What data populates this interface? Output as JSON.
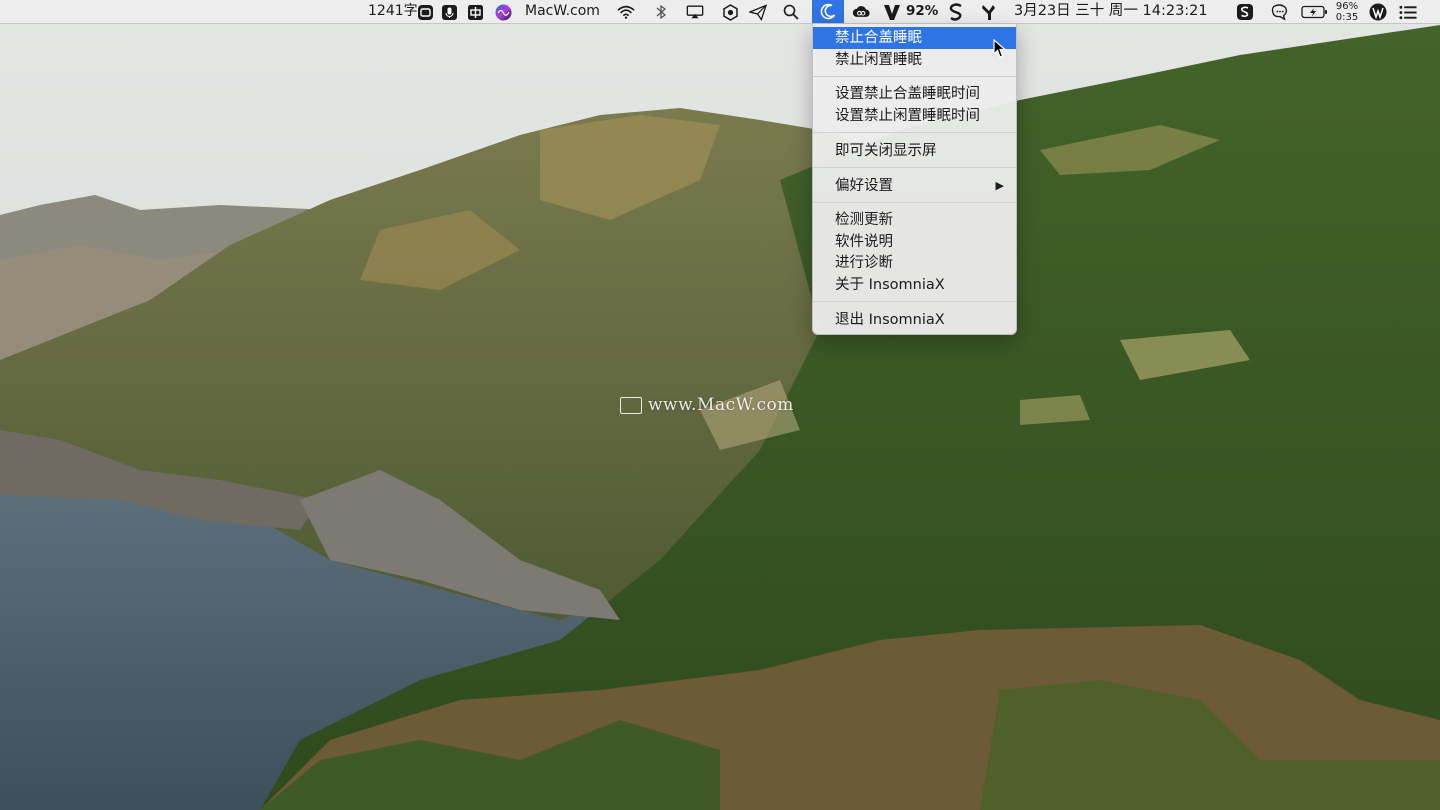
{
  "menubar": {
    "word_count": "1241字",
    "site_label": "MacW.com",
    "battery_percent_text": "92%",
    "datetime": "3月23日 三十 周一 14:23:21",
    "battery_small_percent": "96%",
    "battery_small_time": "0:35",
    "icons": [
      "scanner-icon",
      "microphone-icon",
      "input-method-icon",
      "siri-icon",
      "wifi-icon",
      "bluetooth-icon",
      "airplay-icon",
      "hex-app-icon",
      "paper-plane-icon",
      "search-icon",
      "insomniax-icon",
      "creative-cloud-icon",
      "vectorize-icon",
      "scrivener-icon",
      "tool-icon",
      "sketch-app-icon",
      "chat-icon",
      "battery-charging-icon",
      "wordpress-icon",
      "list-icon"
    ]
  },
  "menu": {
    "items": [
      {
        "label": "禁止合盖睡眠",
        "highlighted": true
      },
      {
        "label": "禁止闲置睡眠"
      },
      {
        "label": "设置禁止合盖睡眠时间"
      },
      {
        "label": "设置禁止闲置睡眠时间"
      },
      {
        "label": "即可关闭显示屏"
      },
      {
        "label": "偏好设置",
        "submenu": true
      },
      {
        "label": "检测更新"
      },
      {
        "label": "软件说明"
      },
      {
        "label": "进行诊断"
      },
      {
        "label": "关于 InsomniaX"
      },
      {
        "label": "退出 InsomniaX"
      }
    ],
    "submenu_arrow": "▶"
  },
  "watermark": "www.MacW.com",
  "colors": {
    "highlight": "#2f74e4",
    "menu_bg": "#ececec"
  }
}
